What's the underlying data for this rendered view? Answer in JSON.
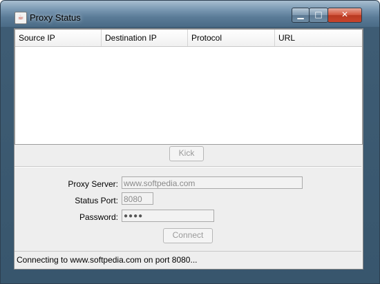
{
  "window": {
    "title": "Proxy Status",
    "minimize_glyph": "▁",
    "maximize_glyph": "□",
    "close_glyph": "✕"
  },
  "table": {
    "columns": [
      "Source IP",
      "Destination IP",
      "Protocol",
      "URL"
    ],
    "rows": []
  },
  "kick_label": "Kick",
  "form": {
    "proxy_server_label": "Proxy Server:",
    "proxy_server_value": "www.softpedia.com",
    "status_port_label": "Status Port:",
    "status_port_value": "8080",
    "password_label": "Password:",
    "password_value": "●●●●"
  },
  "connect_label": "Connect",
  "status": "Connecting to www.softpedia.com on port 8080..."
}
